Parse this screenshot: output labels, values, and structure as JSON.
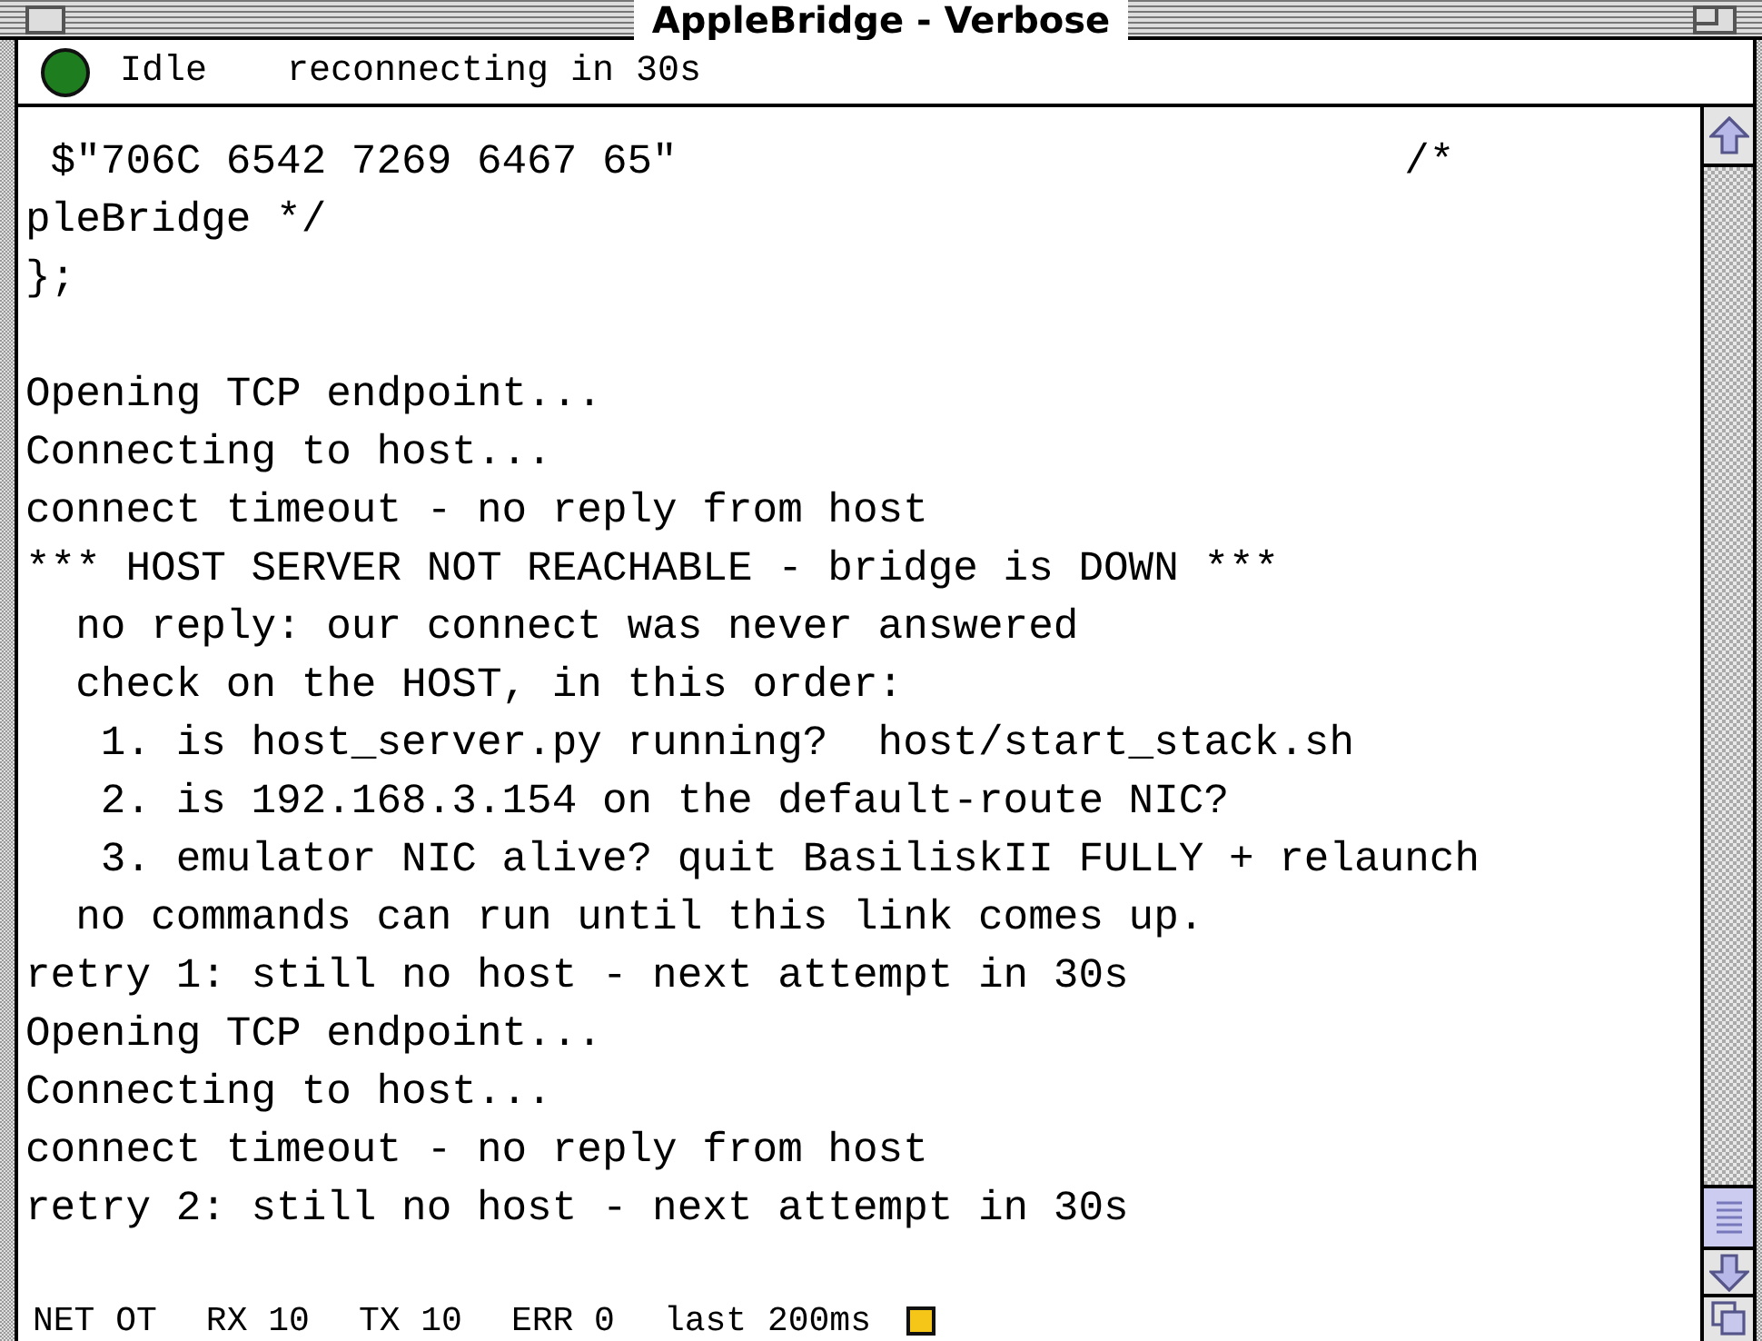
{
  "window": {
    "title": "AppleBridge - Verbose"
  },
  "status": {
    "label": "Idle",
    "message": "reconnecting in 30s"
  },
  "log": {
    "blocks": [
      [
        " $\"706C 6542 7269 6467 65\"                             /*",
        "pleBridge */",
        "};"
      ],
      [
        "Opening TCP endpoint...",
        "Connecting to host...",
        "connect timeout - no reply from host",
        "*** HOST SERVER NOT REACHABLE - bridge is DOWN ***",
        "  no reply: our connect was never answered",
        "  check on the HOST, in this order:",
        "   1. is host_server.py running?  host/start_stack.sh",
        "   2. is 192.168.3.154 on the default-route NIC?",
        "   3. emulator NIC alive? quit BasiliskII FULLY + relaunch",
        "  no commands can run until this link comes up.",
        "retry 1: still no host - next attempt in 30s",
        "Opening TCP endpoint...",
        "Connecting to host...",
        "connect timeout - no reply from host",
        "retry 2: still no host - next attempt in 30s"
      ]
    ]
  },
  "stats": [
    "NET OT",
    "RX 10",
    "TX 10",
    "ERR 0",
    "last 200ms"
  ]
}
